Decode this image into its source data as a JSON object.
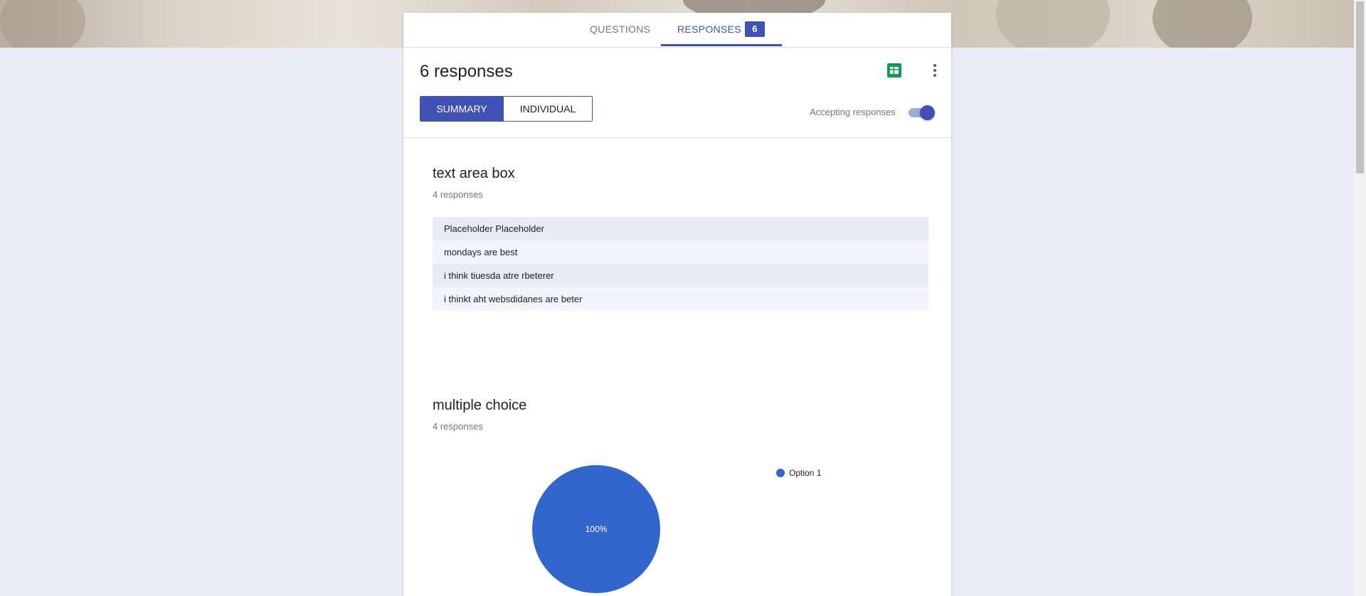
{
  "tabs": {
    "questions_label": "QUESTIONS",
    "responses_label": "RESPONSES",
    "responses_badge": "6"
  },
  "header": {
    "title": "6 responses",
    "sheets_icon": "google-sheets-icon",
    "more_icon": "more-vert-icon",
    "summary_label": "SUMMARY",
    "individual_label": "INDIVIDUAL",
    "accepting_label": "Accepting responses",
    "accepting_on": true
  },
  "questions": [
    {
      "title": "text area box",
      "count": "4 responses",
      "answers": [
        "Placeholder Placeholder",
        "mondays are best",
        "i think tiuesda atre rbeterer",
        "i thinkt aht websdidanes are beter"
      ]
    },
    {
      "title": "multiple choice",
      "count": "4 responses"
    }
  ],
  "chart_data": {
    "type": "pie",
    "categories": [
      "Option 1"
    ],
    "values": [
      100
    ],
    "labels": [
      "100%"
    ],
    "legend": [
      "Option 1"
    ],
    "colors": [
      "#3366cc"
    ],
    "legend_position": "right"
  },
  "colors": {
    "accent": "#3f51b5",
    "pie": "#3366cc",
    "sheets": "#0f9d58"
  }
}
